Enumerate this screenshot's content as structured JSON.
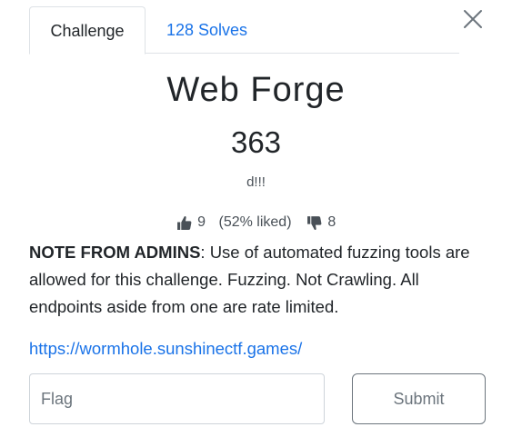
{
  "tabs": [
    {
      "label": "Challenge",
      "active": true
    },
    {
      "label": "128 Solves",
      "active": false
    }
  ],
  "challenge": {
    "name": "Web Forge",
    "value": "363",
    "author": "d!!!"
  },
  "votes": {
    "up": "9",
    "liked": "(52% liked)",
    "down": "8"
  },
  "description": {
    "note_label": "NOTE FROM ADMINS",
    "note_text": ": Use of automated fuzzing tools are allowed for this challenge. Fuzzing. Not Crawling. All endpoints aside from one are rate limited."
  },
  "link": "https://wormhole.sunshinectf.games/",
  "form": {
    "flag_placeholder": "Flag",
    "submit_label": "Submit"
  },
  "icons": {
    "close": "close-icon",
    "thumbs_up": "thumbs-up-icon",
    "thumbs_down": "thumbs-down-icon"
  },
  "colors": {
    "link": "#1a73e8",
    "text": "#212529",
    "muted": "#6c757d"
  }
}
